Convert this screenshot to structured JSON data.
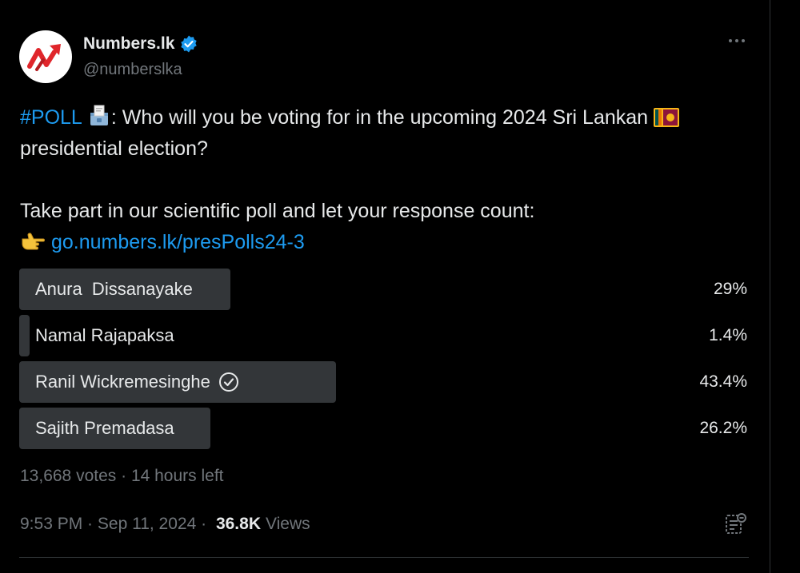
{
  "colors": {
    "background": "#000000",
    "text": "#e7e9ea",
    "muted": "#71767b",
    "link": "#1d9bf0",
    "bar": "#333639"
  },
  "top_fragment": "• ••",
  "author": {
    "name": "Numbers.lk",
    "handle": "@numberslka",
    "avatar_icon": "numbers-lk-logo-icon",
    "verified_icon": "verified-badge-icon"
  },
  "more_icon": "more-options-icon",
  "tweet": {
    "hashtag": "#POLL",
    "ballot_icon": "ballot-box-emoji",
    "line1_text": ": Who will you be voting for in the upcoming 2024 Sri Lankan ",
    "flag_icon": "sri-lanka-flag-emoji",
    "line2_text": "presidential election?",
    "line3_text": "Take part in our scientific poll and let your response count:",
    "pointing_icon": "pointing-hand-emoji",
    "link": "go.numbers.lk/presPolls24-3"
  },
  "poll": {
    "options": [
      {
        "label": "Anura  Dissanayake",
        "percent_text": "29%",
        "fraction": 0.29,
        "selected": false
      },
      {
        "label": "Namal Rajapaksa",
        "percent_text": "1.4%",
        "fraction": 0.014,
        "selected": false
      },
      {
        "label": "Ranil Wickremesinghe",
        "percent_text": "43.4%",
        "fraction": 0.434,
        "selected": true
      },
      {
        "label": "Sajith Premadasa",
        "percent_text": "26.2%",
        "fraction": 0.262,
        "selected": false
      }
    ],
    "votes": "13,668 votes",
    "separator": " · ",
    "time_left": "14 hours left"
  },
  "footer": {
    "time": "9:53 PM",
    "separator": " · ",
    "date": "Sep 11, 2024",
    "views_count": "36.8K",
    "views_label": "Views",
    "analytics_icon": "view-analytics-icon"
  }
}
